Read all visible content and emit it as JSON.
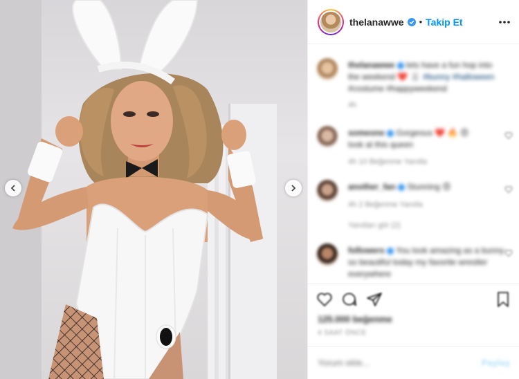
{
  "post": {
    "username": "thelanawwe",
    "verified": true,
    "separator": "•",
    "follow_label": "Takip Et",
    "more_icon": "more-horizontal-icon",
    "colors": {
      "accent": "#0095f6",
      "verified": "#3897f0",
      "text": "#262626",
      "muted": "#8e8e8e"
    }
  },
  "caption": {
    "username": "thelanawwe",
    "text": "lets have a fun hop into the weekend ❤️ 🐰",
    "tags": "#bunny #halloween",
    "extra": "#costume #happyweekend",
    "time": "4h"
  },
  "comments": [
    {
      "username": "someone",
      "text": "Gorgeous ❤️ 🔥 😍",
      "line2": "look at this queen",
      "meta": "4h  10 Beğenme  Yanıtla"
    },
    {
      "username": "another_fan",
      "text": "Stunning 😍",
      "meta": "4h  2 Beğenme  Yanıtla",
      "replies": "Yanıtları gör (2)"
    },
    {
      "username": "followers",
      "text": "You look amazing as a bunny",
      "line2": "so beautiful today my favorite wrestler",
      "line3": "everywhere"
    }
  ],
  "actions": {
    "like_icon": "heart-icon",
    "comment_icon": "comment-icon",
    "share_icon": "share-icon",
    "save_icon": "bookmark-icon"
  },
  "likes": "125.000 beğenme",
  "time_ago": "4 SAAT ÖNCE",
  "add_comment": {
    "placeholder": "Yorum ekle...",
    "post_label": "Paylaş"
  },
  "nav": {
    "prev_icon": "chevron-left-icon",
    "next_icon": "chevron-right-icon"
  }
}
